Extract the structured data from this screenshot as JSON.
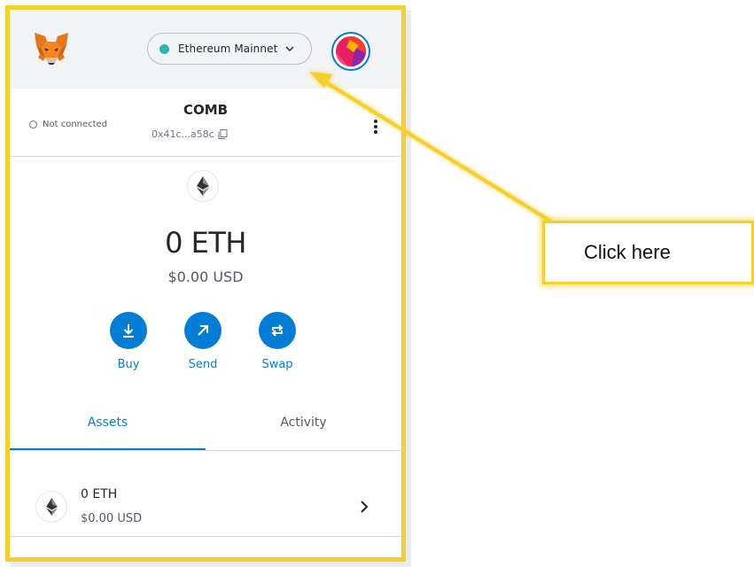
{
  "header": {
    "network_label": "Ethereum Mainnet",
    "network_dot_color": "#29b6af"
  },
  "account": {
    "connection_status": "Not connected",
    "name": "COMB",
    "address": "0x41c...a58c"
  },
  "balance": {
    "amount": "0 ETH",
    "fiat": "$0.00 USD"
  },
  "actions": {
    "buy": "Buy",
    "send": "Send",
    "swap": "Swap"
  },
  "tabs": {
    "assets": "Assets",
    "activity": "Activity"
  },
  "asset_list": [
    {
      "amount": "0 ETH",
      "fiat": "$0.00 USD",
      "icon": "ethereum-icon"
    }
  ],
  "callout": {
    "text": "Click here",
    "color": "#f7cf2a"
  },
  "colors": {
    "accent": "#037dd6",
    "header_bg": "#f2f3f4",
    "frame": "#f7cf2a"
  }
}
